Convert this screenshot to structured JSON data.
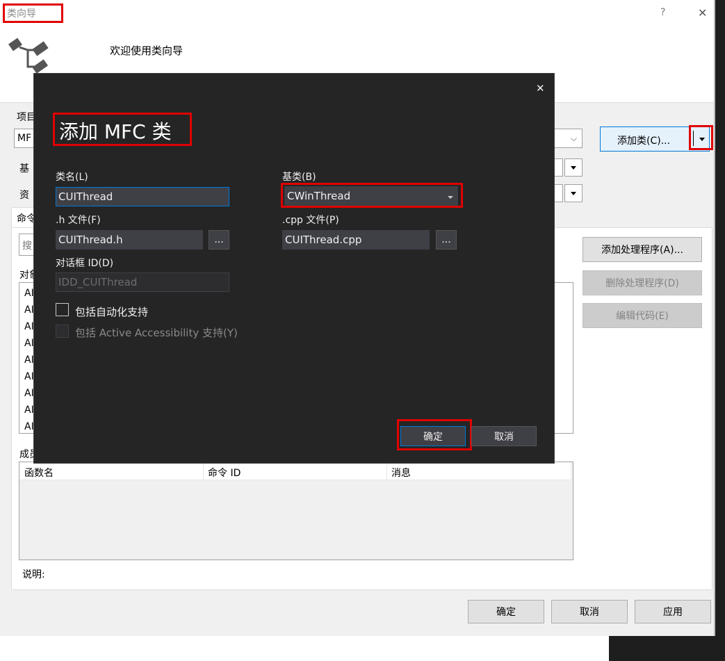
{
  "window": {
    "title": "类向导",
    "help_glyph": "?",
    "close_glyph": "✕",
    "welcome": "欢迎使用类向导"
  },
  "main": {
    "project_label": "项目",
    "project_value": "MF",
    "base_label": "基",
    "resource_label": "资",
    "add_class_button": "添加类(C)...",
    "tab_commands": "命令",
    "search_placeholder": "搜",
    "objects_label": "对象",
    "object_items": [
      "AI",
      "AI",
      "AI",
      "AI",
      "AI",
      "AI",
      "AI",
      "AI",
      "AI"
    ],
    "add_handler_button": "添加处理程序(A)...",
    "delete_handler_button": "删除处理程序(D)",
    "edit_code_button": "编辑代码(E)",
    "members_label": "成员",
    "member_columns": [
      "函数名",
      "命令 ID",
      "消息"
    ],
    "description_label": "说明:",
    "ok_button": "确定",
    "cancel_button": "取消",
    "apply_button": "应用"
  },
  "modal": {
    "title": "添加 MFC 类",
    "close_glyph": "✕",
    "class_name_label": "类名(L)",
    "class_name_value": "CUIThread",
    "base_class_label": "基类(B)",
    "base_class_value": "CWinThread",
    "h_file_label": ".h 文件(F)",
    "h_file_value": "CUIThread.h",
    "cpp_file_label": ".cpp 文件(P)",
    "cpp_file_value": "CUIThread.cpp",
    "browse_label": "...",
    "dialog_id_label": "对话框 ID(D)",
    "dialog_id_value": "IDD_CUIThread",
    "automation_label": "包括自动化支持",
    "accessibility_label": "包括 Active Accessibility 支持(Y)",
    "ok_button": "确定",
    "cancel_button": "取消"
  },
  "colors": {
    "highlight_red": "#e00000",
    "modal_bg": "#252526",
    "modal_input": "#3f3f46",
    "accent_blue": "#0078d7"
  }
}
